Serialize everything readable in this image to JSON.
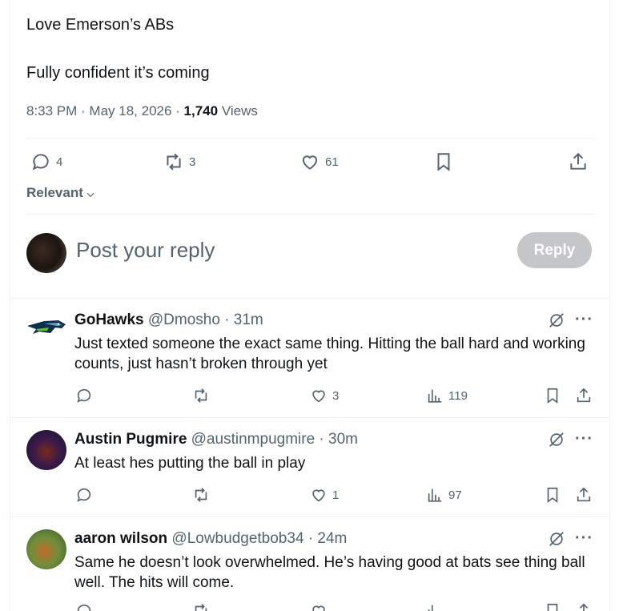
{
  "post": {
    "line1": "Love Emerson’s ABs",
    "line2": "Fully confident it’s coming",
    "time": "8:33 PM · May 18, 2026 · ",
    "views_count": "1,740",
    "views_label": " Views",
    "replies": "4",
    "reposts": "3",
    "likes": "61"
  },
  "sort": {
    "label": "Relevant"
  },
  "composer": {
    "placeholder": "Post your reply",
    "button": "Reply"
  },
  "comments": [
    {
      "name": "GoHawks",
      "handle": " @Dmosho · 31m",
      "text": "Just texted someone the exact same thing. Hitting the ball hard and working counts, just hasn’t broken through yet",
      "likes": "3",
      "views": "119"
    },
    {
      "name": "Austin Pugmire",
      "handle": " @austinmpugmire · 30m",
      "text": "At least hes putting the ball in play",
      "likes": "1",
      "views": "97"
    },
    {
      "name": "aaron wilson",
      "handle": " @Lowbudgetbob34 · 24m",
      "text": "Same he doesn’t look overwhelmed. He’s having good at bats see thing ball well. The hits will come.",
      "likes": "",
      "views": ""
    }
  ],
  "colors": {
    "text": "#0f1419",
    "muted": "#536471",
    "border": "#eff3f4",
    "reply_disabled": "#c4c6c8"
  },
  "icons": [
    "reply-icon",
    "repost-icon",
    "like-icon",
    "bookmark-icon",
    "share-icon",
    "views-icon",
    "grok-icon",
    "more-icon",
    "chevron-down-icon"
  ]
}
